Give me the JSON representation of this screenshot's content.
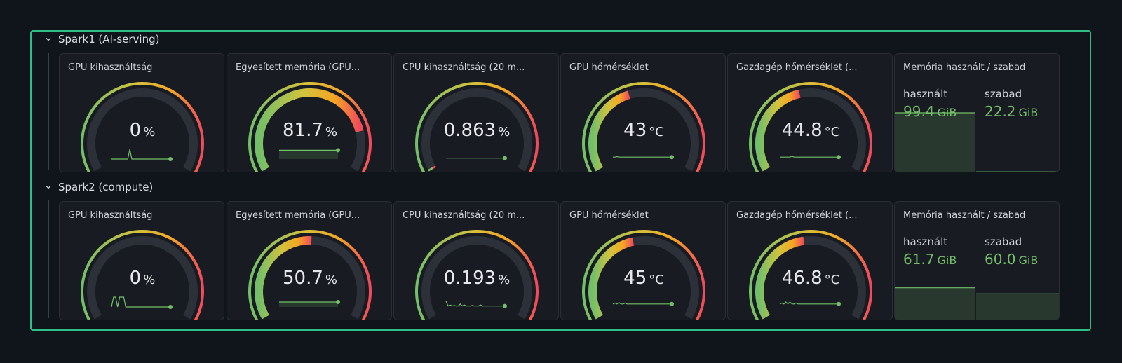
{
  "rows": [
    {
      "title": "Spark1 (AI-serving)",
      "panels": [
        {
          "title": "GPU kihasználtság",
          "value": "0",
          "unit": "%",
          "level": 0,
          "spark": [
            0,
            0,
            0,
            0,
            0,
            0,
            0,
            0,
            0,
            1,
            0,
            0,
            0,
            0,
            0,
            0,
            0,
            0,
            0,
            0,
            0,
            0,
            0,
            0,
            0,
            0,
            0,
            0,
            0,
            0
          ]
        },
        {
          "title": "Egyesített memória (GPU...",
          "value": "81.7",
          "unit": "%",
          "level": 81.7,
          "spark": [
            0.9,
            0.9,
            0.9,
            0.9,
            0.9,
            0.9,
            0.9,
            0.9,
            0.9,
            0.9,
            0.9,
            0.9,
            0.9,
            0.9,
            0.9,
            0.9,
            0.9,
            0.9,
            0.9,
            0.9,
            0.9,
            0.9,
            0.9,
            0.9,
            0.9,
            0.9,
            0.9,
            0.9,
            0.9,
            0.9
          ]
        },
        {
          "title": "CPU kihasználtság (20 m...",
          "value": "0.863",
          "unit": "%",
          "level": 0.863,
          "spark": [
            0.1,
            0.1,
            0.1,
            0.1,
            0.1,
            0.1,
            0.1,
            0.1,
            0.1,
            0.1,
            0.1,
            0.1,
            0.1,
            0.1,
            0.1,
            0.1,
            0.1,
            0.1,
            0.1,
            0.1,
            0.1,
            0.1,
            0.1,
            0.1,
            0.1,
            0.1,
            0.1,
            0.1,
            0.1,
            0.1
          ]
        },
        {
          "title": "GPU hőmérséklet",
          "value": "43",
          "unit": "°C",
          "level": 43,
          "spark": [
            0.2,
            0.2,
            0.25,
            0.2,
            0.2,
            0.2,
            0.2,
            0.2,
            0.2,
            0.2,
            0.2,
            0.2,
            0.2,
            0.2,
            0.2,
            0.2,
            0.2,
            0.2,
            0.2,
            0.2,
            0.2,
            0.2,
            0.2,
            0.2,
            0.2,
            0.2,
            0.2,
            0.2,
            0.2,
            0.2
          ]
        },
        {
          "title": "Gazdagép hőmérséklet (...",
          "value": "44.8",
          "unit": "°C",
          "level": 44.8,
          "spark": [
            0.2,
            0.2,
            0.2,
            0.2,
            0.2,
            0.2,
            0.3,
            0.2,
            0.2,
            0.2,
            0.2,
            0.2,
            0.2,
            0.2,
            0.2,
            0.2,
            0.2,
            0.2,
            0.2,
            0.2,
            0.2,
            0.2,
            0.2,
            0.2,
            0.2,
            0.2,
            0.2,
            0.2,
            0.2,
            0.2
          ]
        }
      ],
      "memory": {
        "title": "Memória használt / szabad",
        "used_label": "használt",
        "used_value": "99.4",
        "used_unit": "GiB",
        "free_label": "szabad",
        "free_value": "22.2",
        "free_unit": "GiB",
        "used_fraction": 0.82
      }
    },
    {
      "title": "Spark2 (compute)",
      "panels": [
        {
          "title": "GPU kihasználtság",
          "value": "0",
          "unit": "%",
          "level": 0,
          "spark": [
            0,
            1,
            1,
            0,
            1,
            1,
            1,
            0,
            0,
            0,
            0,
            0,
            0,
            0,
            0,
            0,
            0,
            0,
            0,
            0,
            0,
            0,
            0,
            0,
            0,
            0,
            0,
            0,
            0,
            0
          ]
        },
        {
          "title": "Egyesített memória (GPU...",
          "value": "50.7",
          "unit": "%",
          "level": 50.7,
          "spark": [
            0.5,
            0.5,
            0.5,
            0.5,
            0.5,
            0.5,
            0.5,
            0.5,
            0.5,
            0.5,
            0.5,
            0.5,
            0.5,
            0.5,
            0.5,
            0.5,
            0.5,
            0.5,
            0.5,
            0.5,
            0.5,
            0.5,
            0.5,
            0.5,
            0.5,
            0.5,
            0.5,
            0.5,
            0.5,
            0.5
          ]
        },
        {
          "title": "CPU kihasználtság (20 m...",
          "value": "0.193",
          "unit": "%",
          "level": 0.193,
          "spark": [
            0.6,
            0.1,
            0.2,
            0.1,
            0.15,
            0.1,
            0.1,
            0.3,
            0.1,
            0.2,
            0.1,
            0.1,
            0.1,
            0.15,
            0.1,
            0.1,
            0.1,
            0.2,
            0.1,
            0.1,
            0.1,
            0.1,
            0.1,
            0.1,
            0.1,
            0.1,
            0.1,
            0.1,
            0.1,
            0.1
          ]
        },
        {
          "title": "GPU hőmérséklet",
          "value": "45",
          "unit": "°C",
          "level": 45,
          "spark": [
            0.3,
            0.4,
            0.3,
            0.45,
            0.3,
            0.3,
            0.4,
            0.3,
            0.3,
            0.3,
            0.3,
            0.3,
            0.3,
            0.3,
            0.3,
            0.3,
            0.3,
            0.3,
            0.3,
            0.3,
            0.3,
            0.3,
            0.3,
            0.3,
            0.3,
            0.3,
            0.3,
            0.3,
            0.3,
            0.3
          ]
        },
        {
          "title": "Gazdagép hőmérséklet (...",
          "value": "46.8",
          "unit": "°C",
          "level": 46.8,
          "spark": [
            0.3,
            0.4,
            0.3,
            0.5,
            0.3,
            0.5,
            0.3,
            0.3,
            0.4,
            0.3,
            0.3,
            0.3,
            0.3,
            0.3,
            0.3,
            0.3,
            0.3,
            0.3,
            0.3,
            0.3,
            0.3,
            0.3,
            0.3,
            0.3,
            0.3,
            0.3,
            0.3,
            0.3,
            0.3,
            0.3
          ]
        }
      ],
      "memory": {
        "title": "Memória használt / szabad",
        "used_label": "használt",
        "used_value": "61.7",
        "used_unit": "GiB",
        "free_label": "szabad",
        "free_value": "60.0",
        "free_unit": "GiB",
        "used_fraction": 0.51
      }
    }
  ],
  "colors": {
    "frame": "#2fbf86",
    "green": "#73bf69",
    "track": "#2c3038",
    "panel": "#181b21"
  }
}
